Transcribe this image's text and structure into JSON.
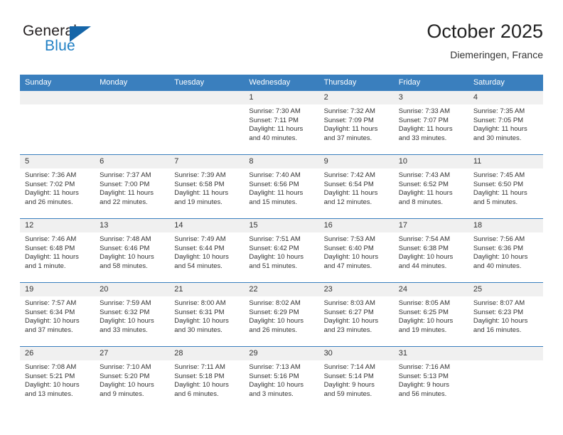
{
  "brand": {
    "word_one": "General",
    "word_two": "Blue",
    "flag_icon": "triangle-flag-icon"
  },
  "header": {
    "title": "October 2025",
    "subtitle": "Diemeringen, France"
  },
  "colors": {
    "header_blue": "#3a7fbe",
    "brand_blue": "#1f7fc4",
    "daynum_band": "#f0f0f0",
    "text": "#333333"
  },
  "weekdays": [
    "Sunday",
    "Monday",
    "Tuesday",
    "Wednesday",
    "Thursday",
    "Friday",
    "Saturday"
  ],
  "labels": {
    "sunrise_prefix": "Sunrise:",
    "sunset_prefix": "Sunset:",
    "daylight_prefix": "Daylight:"
  },
  "weeks": [
    [
      {
        "day": "",
        "blank": true
      },
      {
        "day": "",
        "blank": true
      },
      {
        "day": "",
        "blank": true
      },
      {
        "day": "1",
        "sunrise": "Sunrise: 7:30 AM",
        "sunset": "Sunset: 7:11 PM",
        "daylight_1": "Daylight: 11 hours",
        "daylight_2": "and 40 minutes."
      },
      {
        "day": "2",
        "sunrise": "Sunrise: 7:32 AM",
        "sunset": "Sunset: 7:09 PM",
        "daylight_1": "Daylight: 11 hours",
        "daylight_2": "and 37 minutes."
      },
      {
        "day": "3",
        "sunrise": "Sunrise: 7:33 AM",
        "sunset": "Sunset: 7:07 PM",
        "daylight_1": "Daylight: 11 hours",
        "daylight_2": "and 33 minutes."
      },
      {
        "day": "4",
        "sunrise": "Sunrise: 7:35 AM",
        "sunset": "Sunset: 7:05 PM",
        "daylight_1": "Daylight: 11 hours",
        "daylight_2": "and 30 minutes."
      }
    ],
    [
      {
        "day": "5",
        "sunrise": "Sunrise: 7:36 AM",
        "sunset": "Sunset: 7:02 PM",
        "daylight_1": "Daylight: 11 hours",
        "daylight_2": "and 26 minutes."
      },
      {
        "day": "6",
        "sunrise": "Sunrise: 7:37 AM",
        "sunset": "Sunset: 7:00 PM",
        "daylight_1": "Daylight: 11 hours",
        "daylight_2": "and 22 minutes."
      },
      {
        "day": "7",
        "sunrise": "Sunrise: 7:39 AM",
        "sunset": "Sunset: 6:58 PM",
        "daylight_1": "Daylight: 11 hours",
        "daylight_2": "and 19 minutes."
      },
      {
        "day": "8",
        "sunrise": "Sunrise: 7:40 AM",
        "sunset": "Sunset: 6:56 PM",
        "daylight_1": "Daylight: 11 hours",
        "daylight_2": "and 15 minutes."
      },
      {
        "day": "9",
        "sunrise": "Sunrise: 7:42 AM",
        "sunset": "Sunset: 6:54 PM",
        "daylight_1": "Daylight: 11 hours",
        "daylight_2": "and 12 minutes."
      },
      {
        "day": "10",
        "sunrise": "Sunrise: 7:43 AM",
        "sunset": "Sunset: 6:52 PM",
        "daylight_1": "Daylight: 11 hours",
        "daylight_2": "and 8 minutes."
      },
      {
        "day": "11",
        "sunrise": "Sunrise: 7:45 AM",
        "sunset": "Sunset: 6:50 PM",
        "daylight_1": "Daylight: 11 hours",
        "daylight_2": "and 5 minutes."
      }
    ],
    [
      {
        "day": "12",
        "sunrise": "Sunrise: 7:46 AM",
        "sunset": "Sunset: 6:48 PM",
        "daylight_1": "Daylight: 11 hours",
        "daylight_2": "and 1 minute."
      },
      {
        "day": "13",
        "sunrise": "Sunrise: 7:48 AM",
        "sunset": "Sunset: 6:46 PM",
        "daylight_1": "Daylight: 10 hours",
        "daylight_2": "and 58 minutes."
      },
      {
        "day": "14",
        "sunrise": "Sunrise: 7:49 AM",
        "sunset": "Sunset: 6:44 PM",
        "daylight_1": "Daylight: 10 hours",
        "daylight_2": "and 54 minutes."
      },
      {
        "day": "15",
        "sunrise": "Sunrise: 7:51 AM",
        "sunset": "Sunset: 6:42 PM",
        "daylight_1": "Daylight: 10 hours",
        "daylight_2": "and 51 minutes."
      },
      {
        "day": "16",
        "sunrise": "Sunrise: 7:53 AM",
        "sunset": "Sunset: 6:40 PM",
        "daylight_1": "Daylight: 10 hours",
        "daylight_2": "and 47 minutes."
      },
      {
        "day": "17",
        "sunrise": "Sunrise: 7:54 AM",
        "sunset": "Sunset: 6:38 PM",
        "daylight_1": "Daylight: 10 hours",
        "daylight_2": "and 44 minutes."
      },
      {
        "day": "18",
        "sunrise": "Sunrise: 7:56 AM",
        "sunset": "Sunset: 6:36 PM",
        "daylight_1": "Daylight: 10 hours",
        "daylight_2": "and 40 minutes."
      }
    ],
    [
      {
        "day": "19",
        "sunrise": "Sunrise: 7:57 AM",
        "sunset": "Sunset: 6:34 PM",
        "daylight_1": "Daylight: 10 hours",
        "daylight_2": "and 37 minutes."
      },
      {
        "day": "20",
        "sunrise": "Sunrise: 7:59 AM",
        "sunset": "Sunset: 6:32 PM",
        "daylight_1": "Daylight: 10 hours",
        "daylight_2": "and 33 minutes."
      },
      {
        "day": "21",
        "sunrise": "Sunrise: 8:00 AM",
        "sunset": "Sunset: 6:31 PM",
        "daylight_1": "Daylight: 10 hours",
        "daylight_2": "and 30 minutes."
      },
      {
        "day": "22",
        "sunrise": "Sunrise: 8:02 AM",
        "sunset": "Sunset: 6:29 PM",
        "daylight_1": "Daylight: 10 hours",
        "daylight_2": "and 26 minutes."
      },
      {
        "day": "23",
        "sunrise": "Sunrise: 8:03 AM",
        "sunset": "Sunset: 6:27 PM",
        "daylight_1": "Daylight: 10 hours",
        "daylight_2": "and 23 minutes."
      },
      {
        "day": "24",
        "sunrise": "Sunrise: 8:05 AM",
        "sunset": "Sunset: 6:25 PM",
        "daylight_1": "Daylight: 10 hours",
        "daylight_2": "and 19 minutes."
      },
      {
        "day": "25",
        "sunrise": "Sunrise: 8:07 AM",
        "sunset": "Sunset: 6:23 PM",
        "daylight_1": "Daylight: 10 hours",
        "daylight_2": "and 16 minutes."
      }
    ],
    [
      {
        "day": "26",
        "sunrise": "Sunrise: 7:08 AM",
        "sunset": "Sunset: 5:21 PM",
        "daylight_1": "Daylight: 10 hours",
        "daylight_2": "and 13 minutes."
      },
      {
        "day": "27",
        "sunrise": "Sunrise: 7:10 AM",
        "sunset": "Sunset: 5:20 PM",
        "daylight_1": "Daylight: 10 hours",
        "daylight_2": "and 9 minutes."
      },
      {
        "day": "28",
        "sunrise": "Sunrise: 7:11 AM",
        "sunset": "Sunset: 5:18 PM",
        "daylight_1": "Daylight: 10 hours",
        "daylight_2": "and 6 minutes."
      },
      {
        "day": "29",
        "sunrise": "Sunrise: 7:13 AM",
        "sunset": "Sunset: 5:16 PM",
        "daylight_1": "Daylight: 10 hours",
        "daylight_2": "and 3 minutes."
      },
      {
        "day": "30",
        "sunrise": "Sunrise: 7:14 AM",
        "sunset": "Sunset: 5:14 PM",
        "daylight_1": "Daylight: 9 hours",
        "daylight_2": "and 59 minutes."
      },
      {
        "day": "31",
        "sunrise": "Sunrise: 7:16 AM",
        "sunset": "Sunset: 5:13 PM",
        "daylight_1": "Daylight: 9 hours",
        "daylight_2": "and 56 minutes."
      },
      {
        "day": "",
        "blank": true
      }
    ]
  ]
}
